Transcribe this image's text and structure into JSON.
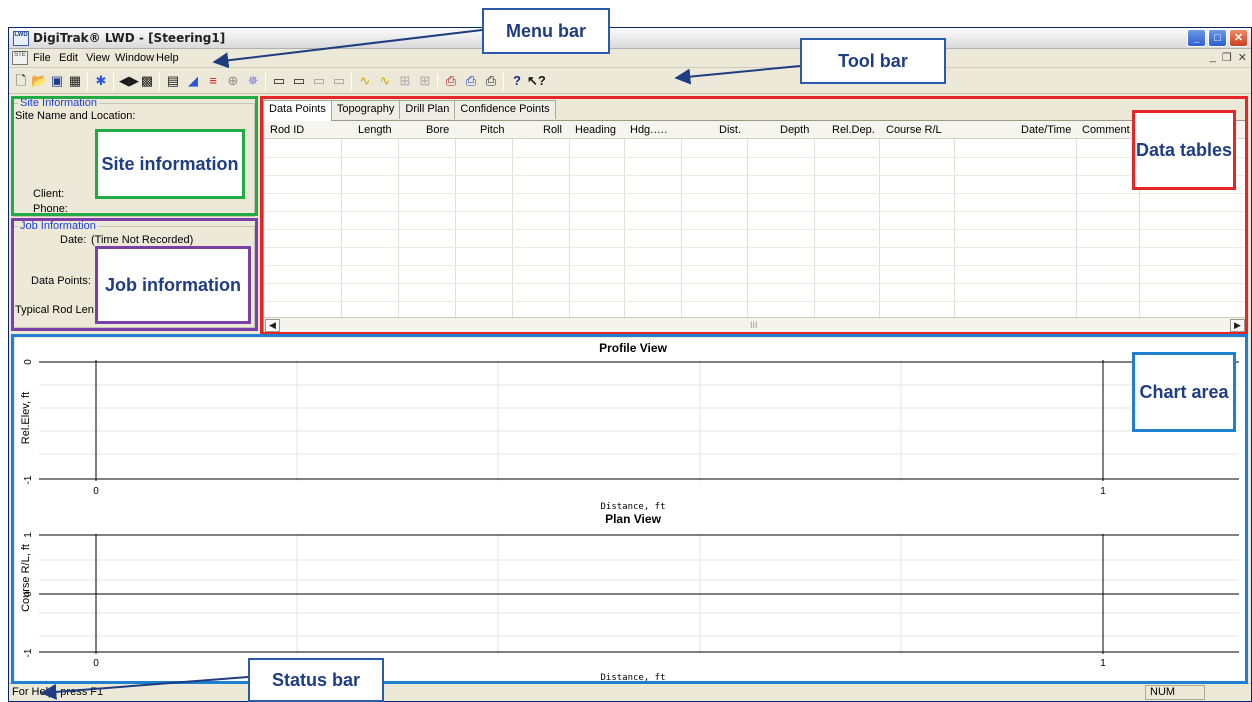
{
  "window": {
    "title": "DigiTrak® LWD - [Steering1]",
    "icon_text": "LWD",
    "buttons": [
      "_",
      "□",
      "✕"
    ]
  },
  "menubar": {
    "icon_text": "STE",
    "items": [
      "File",
      "Edit",
      "View",
      "Window",
      "Help"
    ],
    "mdi_buttons": [
      "_",
      "❐",
      "✕"
    ]
  },
  "toolbar": {
    "icons": [
      "new-file-icon",
      "open-folder-icon",
      "save-icon",
      "table-icon",
      "bluetooth-icon",
      "connect-icon",
      "import-icon",
      "report-icon",
      "chart-icon",
      "legend-icon",
      "target-icon",
      "settings-icon",
      "view1-icon",
      "view2-icon",
      "view3-icon",
      "view4-icon",
      "curve1-icon",
      "curve2-icon",
      "fit1-icon",
      "fit2-icon",
      "print1-icon",
      "print-preview-icon",
      "print-icon",
      "help-icon",
      "context-help-icon"
    ]
  },
  "site_information": {
    "title": "Site Information",
    "site_name_label": "Site Name and Location:",
    "client_label": "Client:",
    "phone_label": "Phone:"
  },
  "job_information": {
    "title": "Job Information",
    "date_label": "Date:",
    "date_value": "(Time Not Recorded)",
    "data_points_label": "Data Points:",
    "rod_length_label": "Typical Rod Len"
  },
  "data_tables": {
    "tabs": [
      "Data Points",
      "Topography",
      "Drill Plan",
      "Confidence Points"
    ],
    "active_tab": 0,
    "columns": [
      "Rod ID",
      "Length",
      "Bore",
      "Pitch",
      "Roll",
      "Heading",
      "Hdg.….",
      "Dist.",
      "Depth",
      "Rel.Dep.",
      "Course R/L",
      "Date/Time",
      "Comment"
    ],
    "scroll_mid": "III"
  },
  "charts": {
    "profile": {
      "title": "Profile View",
      "xlabel": "Distance, ft",
      "ylabel": "Rel.Elev, ft",
      "y_ticks": [
        "0",
        "-1"
      ],
      "x_ticks": [
        "0",
        "1"
      ]
    },
    "plan": {
      "title": "Plan View",
      "xlabel": "Distance, ft",
      "ylabel": "Course R/L, ft",
      "y_ticks": [
        "1",
        "0",
        "-1"
      ],
      "x_ticks": [
        "0",
        "1"
      ]
    }
  },
  "statusbar": {
    "text": "For Help, press F1",
    "num": "NUM"
  },
  "callouts": {
    "menu_bar": "Menu bar",
    "tool_bar": "Tool bar",
    "site_information": "Site information",
    "job_information": "Job information",
    "data_tables": "Data tables",
    "chart_area": "Chart area",
    "status_bar": "Status bar"
  },
  "colors": {
    "site_box": "#22aa44",
    "job_box": "#7b3fa8",
    "data_box": "#e52626",
    "chart_box": "#1f7fd0",
    "callout_text": "#1f3d82"
  }
}
